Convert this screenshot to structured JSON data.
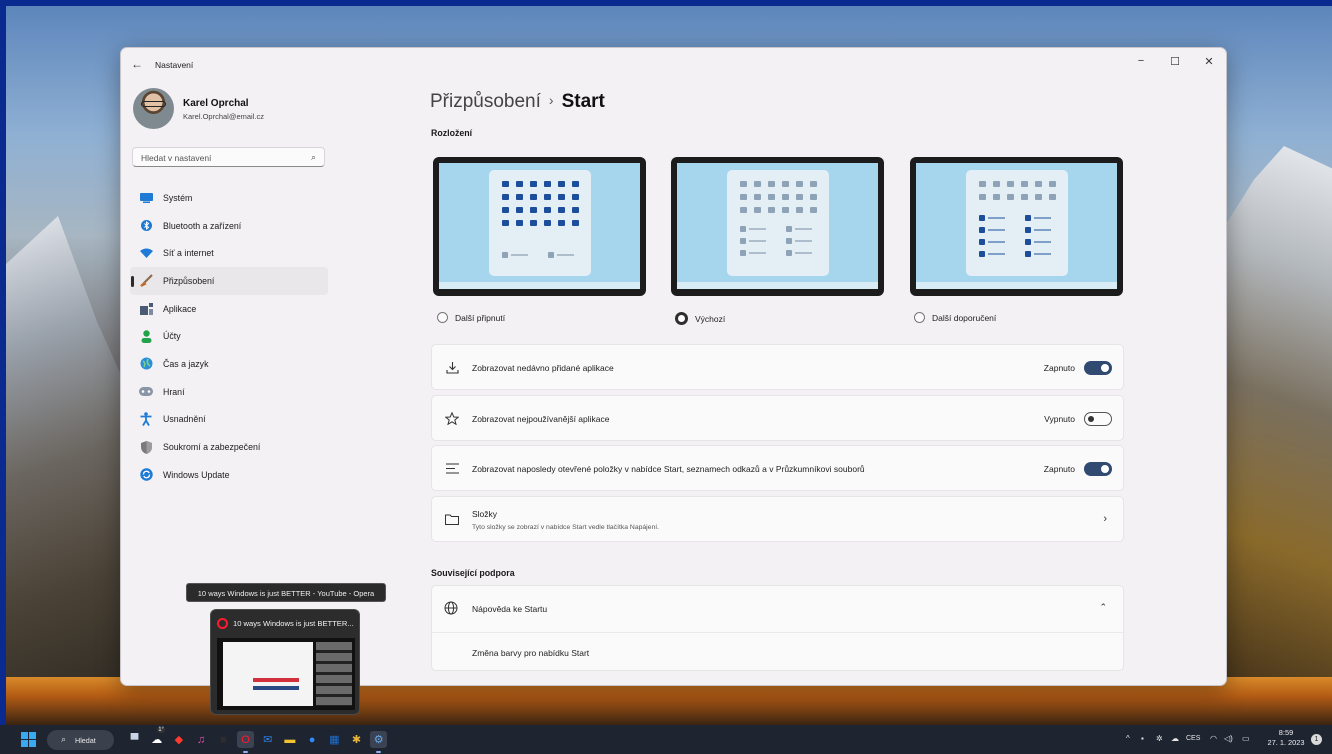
{
  "window": {
    "title": "Nastavení",
    "controls": {
      "minimize": "−",
      "maximize": "☐",
      "close": "✕"
    }
  },
  "profile": {
    "name": "Karel Oprchal",
    "email": "Karel.Oprchal@email.cz"
  },
  "search": {
    "placeholder": "Hledat v nastavení"
  },
  "sidebar": {
    "items": [
      {
        "label": "Systém",
        "icon": "monitor-icon",
        "color": "#1f7ad6"
      },
      {
        "label": "Bluetooth a zařízení",
        "icon": "bluetooth-icon",
        "color": "#1f7ad6"
      },
      {
        "label": "Síť a internet",
        "icon": "wifi-icon",
        "color": "#1f7ad6"
      },
      {
        "label": "Přizpůsobení",
        "icon": "brush-icon",
        "color": "#c06a2b",
        "active": true
      },
      {
        "label": "Aplikace",
        "icon": "apps-icon",
        "color": "#4a5a74"
      },
      {
        "label": "Účty",
        "icon": "person-icon",
        "color": "#22a34a"
      },
      {
        "label": "Čas a jazyk",
        "icon": "globe-clock-icon",
        "color": "#1f7ad6"
      },
      {
        "label": "Hraní",
        "icon": "gamepad-icon",
        "color": "#7b8796"
      },
      {
        "label": "Usnadnění",
        "icon": "accessibility-icon",
        "color": "#1f7ad6"
      },
      {
        "label": "Soukromí a zabezpečení",
        "icon": "shield-icon",
        "color": "#6b6b6b"
      },
      {
        "label": "Windows Update",
        "icon": "update-icon",
        "color": "#1f7ad6"
      }
    ]
  },
  "main": {
    "breadcrumb": {
      "parent": "Přizpůsobení",
      "separator": "›",
      "current": "Start"
    },
    "layout_section": "Rozložení",
    "layout_options": [
      {
        "label": "Další připnutí",
        "selected": false
      },
      {
        "label": "Výchozí",
        "selected": true
      },
      {
        "label": "Další doporučení",
        "selected": false
      }
    ],
    "settings": [
      {
        "label": "Zobrazovat nedávno přidané aplikace",
        "state": "Zapnuto",
        "on": true,
        "icon": "download-icon"
      },
      {
        "label": "Zobrazovat nejpoužívanější aplikace",
        "state": "Vypnuto",
        "on": false,
        "icon": "star-icon"
      },
      {
        "label": "Zobrazovat naposledy otevřené položky v nabídce Start, seznamech odkazů a v Průzkumníkovi souborů",
        "state": "Zapnuto",
        "on": true,
        "icon": "list-icon"
      }
    ],
    "folders": {
      "label": "Složky",
      "sub": "Tyto složky se zobrazí v nabídce Start vedle tlačítka Napájení.",
      "icon": "folder-icon"
    },
    "support_section": "Související podpora",
    "help": {
      "label": "Nápověda ke Startu",
      "icon": "globe-icon",
      "link": "Změna barvy pro nabídku Start"
    }
  },
  "tooltip": {
    "text": "10 ways Windows is just BETTER - YouTube - Opera"
  },
  "thumbnail": {
    "title": "10 ways Windows is just BETTER..."
  },
  "taskbar": {
    "search_label": "Hledat",
    "weather_badge": "1°",
    "tray": {
      "chevron": "^",
      "language": "CES"
    },
    "clock": {
      "time": "8:59",
      "date": "27. 1. 2023"
    },
    "notification_count": "1",
    "apps": [
      {
        "name": "task-view",
        "glyph": "▀",
        "color": "#c9d4e6"
      },
      {
        "name": "weather",
        "glyph": "☁",
        "color": "#ffffff"
      },
      {
        "name": "redapp",
        "glyph": "◆",
        "color": "#ff3b30"
      },
      {
        "name": "itunes",
        "glyph": "♫",
        "color": "#e84fa8"
      },
      {
        "name": "terminal",
        "glyph": "■",
        "color": "#2d2d2d"
      },
      {
        "name": "opera",
        "glyph": "O",
        "color": "#ff1b2d",
        "active": true
      },
      {
        "name": "mail",
        "glyph": "✉",
        "color": "#2b7fe0"
      },
      {
        "name": "explorer",
        "glyph": "▬",
        "color": "#f4c430"
      },
      {
        "name": "zoom",
        "glyph": "●",
        "color": "#2d8cff"
      },
      {
        "name": "trello",
        "glyph": "▦",
        "color": "#1f6fd1"
      },
      {
        "name": "slack",
        "glyph": "✱",
        "color": "#e8b43a"
      },
      {
        "name": "settings",
        "glyph": "⚙",
        "color": "#6aa8e6",
        "active": true
      }
    ]
  }
}
